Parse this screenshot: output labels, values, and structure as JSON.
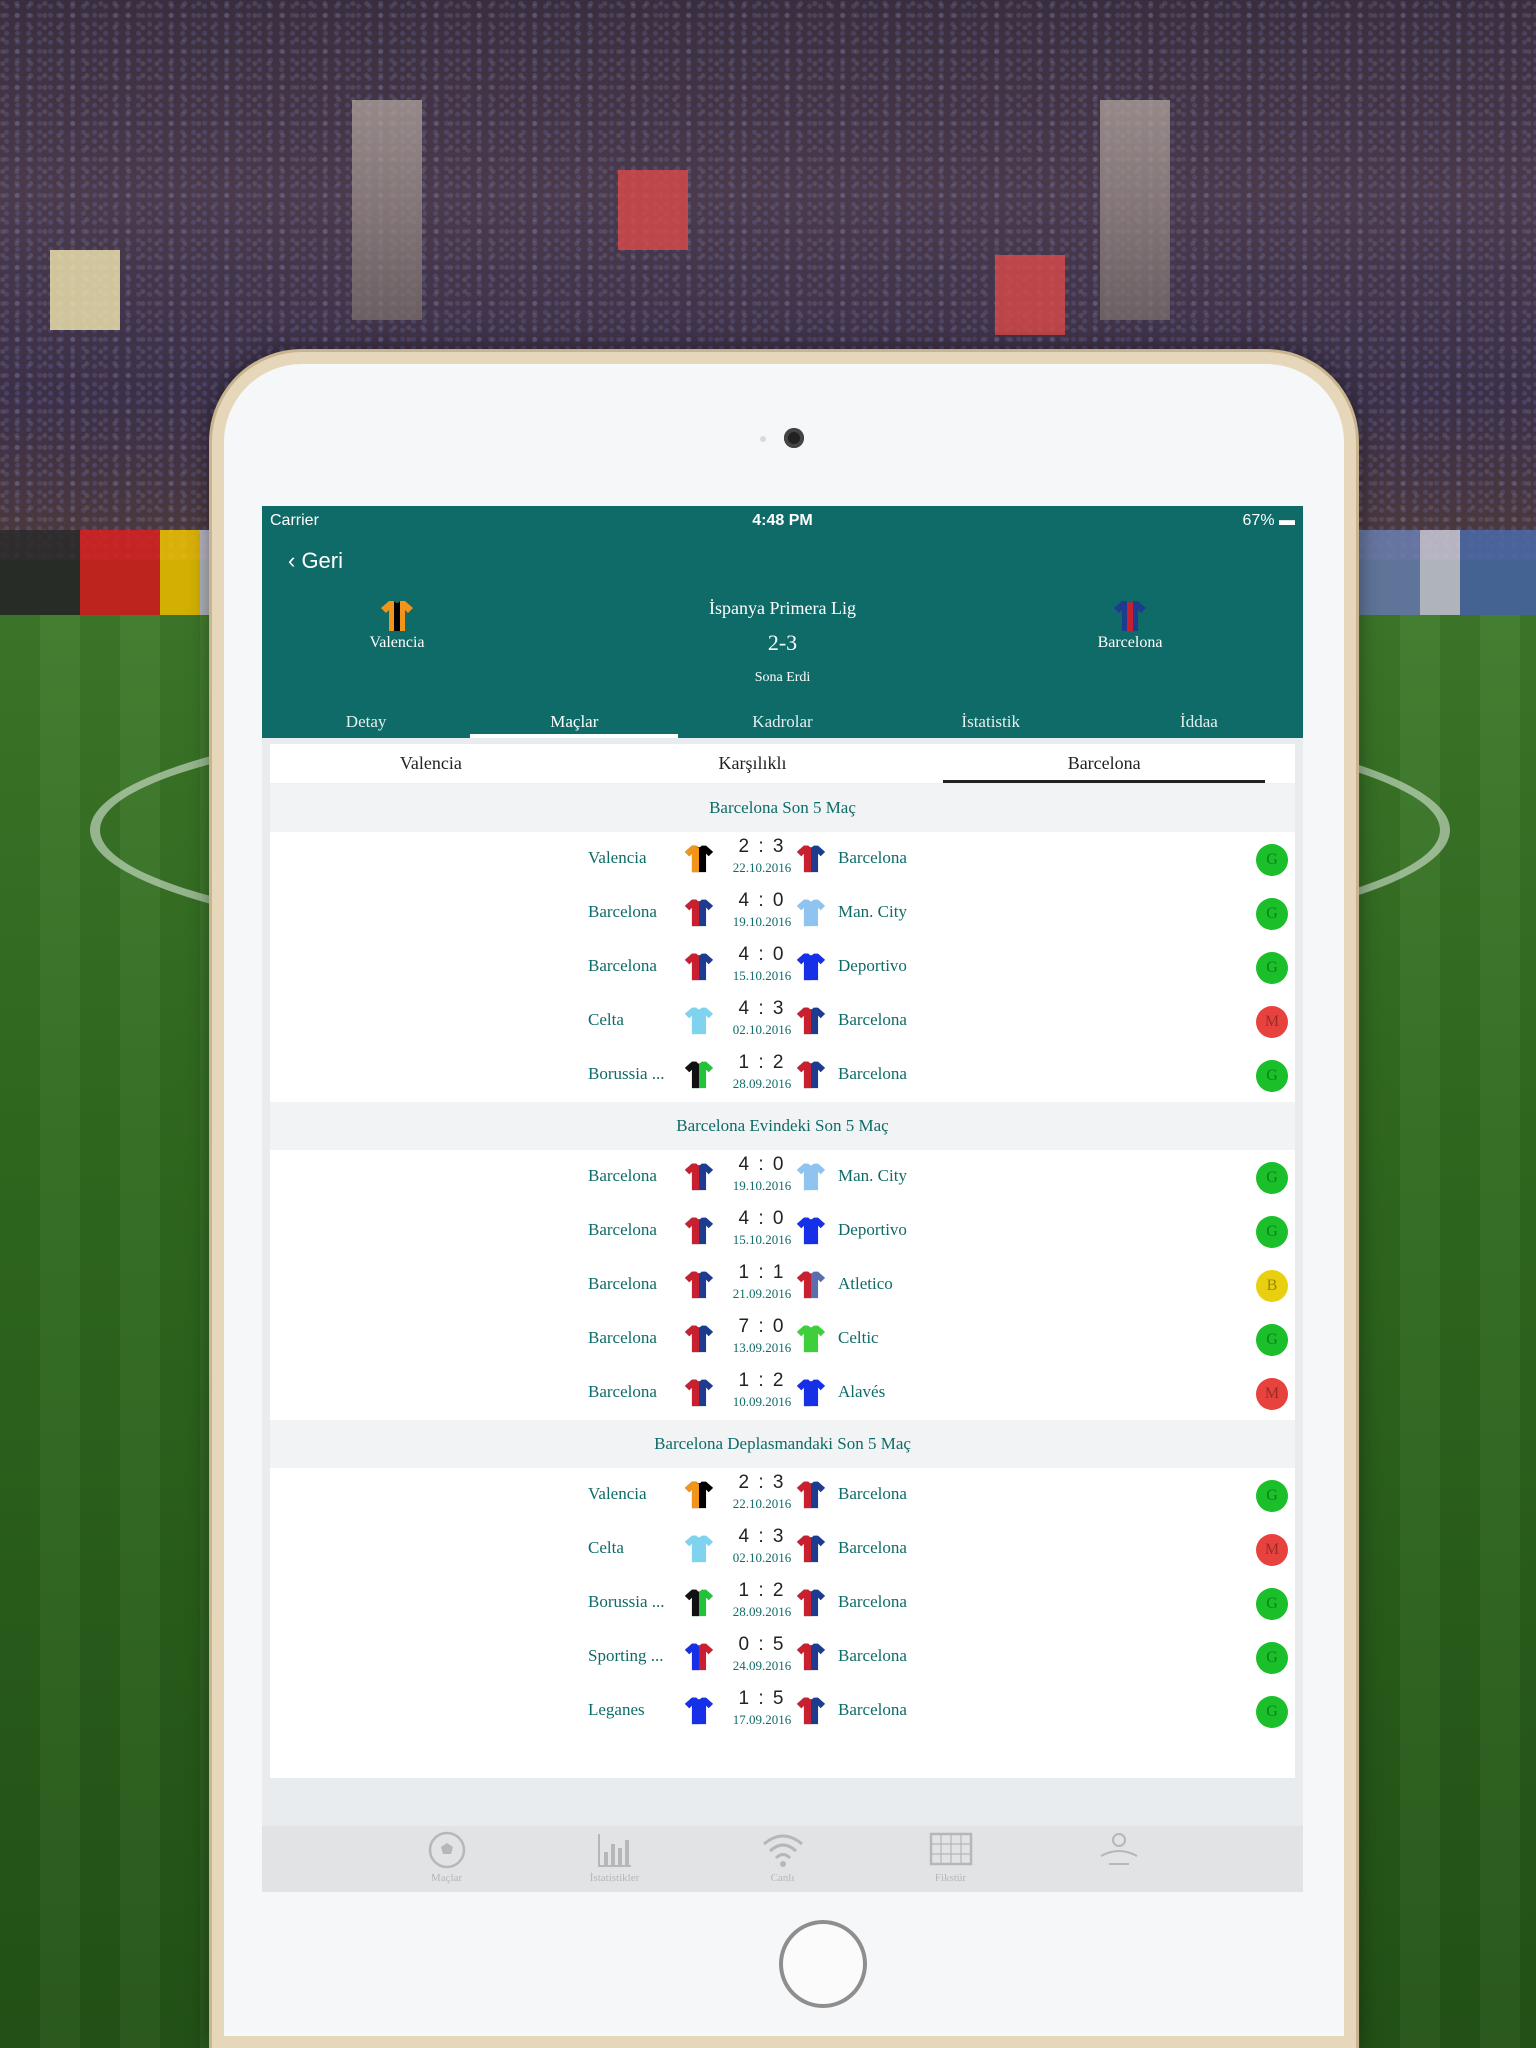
{
  "status": {
    "carrier": "Carrier",
    "time": "4:48 PM",
    "battery": "67%"
  },
  "header": {
    "back_label": "‹ Geri",
    "league": "İspanya Primera Lig",
    "score": "2-3",
    "state": "Sona Erdi",
    "home_team": "Valencia",
    "away_team": "Barcelona"
  },
  "tabs": [
    {
      "label": "Detay",
      "active": false
    },
    {
      "label": "Maçlar",
      "active": true
    },
    {
      "label": "Kadrolar",
      "active": false
    },
    {
      "label": "İstatistik",
      "active": false
    },
    {
      "label": "İddaa",
      "active": false
    }
  ],
  "subtabs": [
    {
      "label": "Valencia",
      "active": false
    },
    {
      "label": "Karşılıklı",
      "active": false
    },
    {
      "label": "Barcelona",
      "active": true
    }
  ],
  "colors": {
    "teal": "#0f6b68",
    "win": "#1bbf2a",
    "loss": "#e8423f",
    "draw": "#e8cf10"
  },
  "sections": [
    {
      "title": "Barcelona Son 5 Maç",
      "matches": [
        {
          "home": "Valencia",
          "home_shirt": [
            "#f2931a",
            "#000000"
          ],
          "score": "2 : 3",
          "date": "22.10.2016",
          "away": "Barcelona",
          "away_shirt": [
            "#c8202f",
            "#1d3b8f"
          ],
          "result": "G"
        },
        {
          "home": "Barcelona",
          "home_shirt": [
            "#c8202f",
            "#1d3b8f"
          ],
          "score": "4 : 0",
          "date": "19.10.2016",
          "away": "Man. City",
          "away_shirt": [
            "#8fc3f0",
            "#8fc3f0"
          ],
          "result": "G"
        },
        {
          "home": "Barcelona",
          "home_shirt": [
            "#c8202f",
            "#1d3b8f"
          ],
          "score": "4 : 0",
          "date": "15.10.2016",
          "away": "Deportivo",
          "away_shirt": [
            "#1630e8",
            "#1630e8"
          ],
          "result": "G"
        },
        {
          "home": "Celta",
          "home_shirt": [
            "#7fd3ef",
            "#7fd3ef"
          ],
          "score": "4 : 3",
          "date": "02.10.2016",
          "away": "Barcelona",
          "away_shirt": [
            "#c8202f",
            "#1d3b8f"
          ],
          "result": "M"
        },
        {
          "home": "Borussia ...",
          "home_shirt": [
            "#111111",
            "#22c23a"
          ],
          "score": "1 : 2",
          "date": "28.09.2016",
          "away": "Barcelona",
          "away_shirt": [
            "#c8202f",
            "#1d3b8f"
          ],
          "result": "G"
        }
      ]
    },
    {
      "title": "Barcelona Evindeki Son 5 Maç",
      "matches": [
        {
          "home": "Barcelona",
          "home_shirt": [
            "#c8202f",
            "#1d3b8f"
          ],
          "score": "4 : 0",
          "date": "19.10.2016",
          "away": "Man. City",
          "away_shirt": [
            "#8fc3f0",
            "#8fc3f0"
          ],
          "result": "G"
        },
        {
          "home": "Barcelona",
          "home_shirt": [
            "#c8202f",
            "#1d3b8f"
          ],
          "score": "4 : 0",
          "date": "15.10.2016",
          "away": "Deportivo",
          "away_shirt": [
            "#1630e8",
            "#1630e8"
          ],
          "result": "G"
        },
        {
          "home": "Barcelona",
          "home_shirt": [
            "#c8202f",
            "#1d3b8f"
          ],
          "score": "1 : 1",
          "date": "21.09.2016",
          "away": "Atletico",
          "away_shirt": [
            "#c8202f",
            "#5a6fae"
          ],
          "result": "B"
        },
        {
          "home": "Barcelona",
          "home_shirt": [
            "#c8202f",
            "#1d3b8f"
          ],
          "score": "7 : 0",
          "date": "13.09.2016",
          "away": "Celtic",
          "away_shirt": [
            "#3fcf3a",
            "#3fcf3a"
          ],
          "result": "G"
        },
        {
          "home": "Barcelona",
          "home_shirt": [
            "#c8202f",
            "#1d3b8f"
          ],
          "score": "1 : 2",
          "date": "10.09.2016",
          "away": "Alavés",
          "away_shirt": [
            "#1630e8",
            "#1630e8"
          ],
          "result": "M"
        }
      ]
    },
    {
      "title": "Barcelona Deplasmandaki Son 5 Maç",
      "matches": [
        {
          "home": "Valencia",
          "home_shirt": [
            "#f2931a",
            "#000000"
          ],
          "score": "2 : 3",
          "date": "22.10.2016",
          "away": "Barcelona",
          "away_shirt": [
            "#c8202f",
            "#1d3b8f"
          ],
          "result": "G"
        },
        {
          "home": "Celta",
          "home_shirt": [
            "#7fd3ef",
            "#7fd3ef"
          ],
          "score": "4 : 3",
          "date": "02.10.2016",
          "away": "Barcelona",
          "away_shirt": [
            "#c8202f",
            "#1d3b8f"
          ],
          "result": "M"
        },
        {
          "home": "Borussia ...",
          "home_shirt": [
            "#111111",
            "#22c23a"
          ],
          "score": "1 : 2",
          "date": "28.09.2016",
          "away": "Barcelona",
          "away_shirt": [
            "#c8202f",
            "#1d3b8f"
          ],
          "result": "G"
        },
        {
          "home": "Sporting ...",
          "home_shirt": [
            "#1630e8",
            "#c8202f"
          ],
          "score": "0 : 5",
          "date": "24.09.2016",
          "away": "Barcelona",
          "away_shirt": [
            "#c8202f",
            "#1d3b8f"
          ],
          "result": "G"
        },
        {
          "home": "Leganes",
          "home_shirt": [
            "#1630e8",
            "#1630e8"
          ],
          "score": "1 : 5",
          "date": "17.09.2016",
          "away": "Barcelona",
          "away_shirt": [
            "#c8202f",
            "#1d3b8f"
          ],
          "result": "G"
        }
      ]
    }
  ],
  "tabbar": [
    {
      "label": "Maçlar",
      "icon": "soccer-ball-icon"
    },
    {
      "label": "İstatistikler",
      "icon": "bar-chart-icon"
    },
    {
      "label": "Canlı",
      "icon": "wifi-icon"
    },
    {
      "label": "Fikstür",
      "icon": "goal-net-icon"
    },
    {
      "label": "",
      "icon": "app-logo-icon"
    }
  ]
}
